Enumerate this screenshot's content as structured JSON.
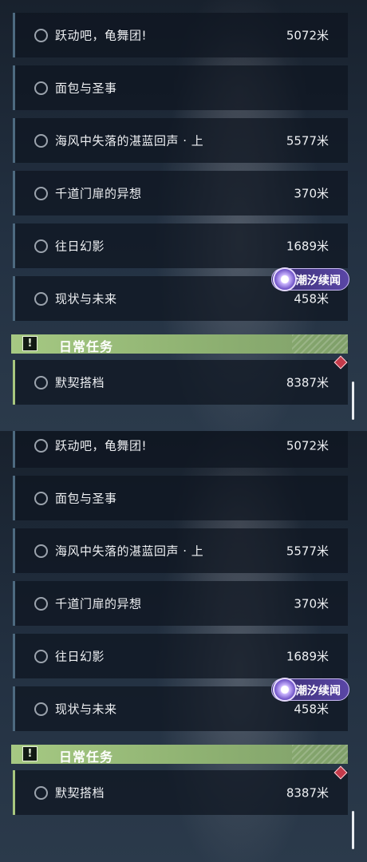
{
  "panels": [
    {
      "quests": [
        {
          "title": "跃动吧，龟舞团!",
          "distance": "5072米"
        },
        {
          "title": "面包与圣事",
          "distance": ""
        },
        {
          "title": "海风中失落的湛蓝回声 · 上",
          "distance": "5577米"
        },
        {
          "title": "千道门扉的异想",
          "distance": "370米"
        },
        {
          "title": "往日幻影",
          "distance": "1689米"
        },
        {
          "title": "现状与未来",
          "distance": "458米"
        }
      ],
      "badge": {
        "text": "潮汐续闻",
        "icon": "tidal-echo-icon"
      },
      "daily_header": {
        "icon_text": "!",
        "title": "日常任务"
      },
      "daily_quest": {
        "title": "默契搭档",
        "distance": "8387米"
      }
    },
    {
      "quests": [
        {
          "title": "跃动吧，龟舞团!",
          "distance": "5072米"
        },
        {
          "title": "面包与圣事",
          "distance": ""
        },
        {
          "title": "海风中失落的湛蓝回声 · 上",
          "distance": "5577米"
        },
        {
          "title": "千道门扉的异想",
          "distance": "370米"
        },
        {
          "title": "往日幻影",
          "distance": "1689米"
        },
        {
          "title": "现状与未来",
          "distance": "458米"
        }
      ],
      "badge": {
        "text": "潮汐续闻",
        "icon": "tidal-echo-icon"
      },
      "daily_header": {
        "icon_text": "!",
        "title": "日常任务"
      },
      "daily_quest": {
        "title": "默契搭档",
        "distance": "8387米"
      }
    }
  ],
  "colors": {
    "daily_accent": "#a8c77f",
    "quest_accent": "#4d6a80",
    "badge": "#5a46a6",
    "alert": "#c43a4a"
  }
}
